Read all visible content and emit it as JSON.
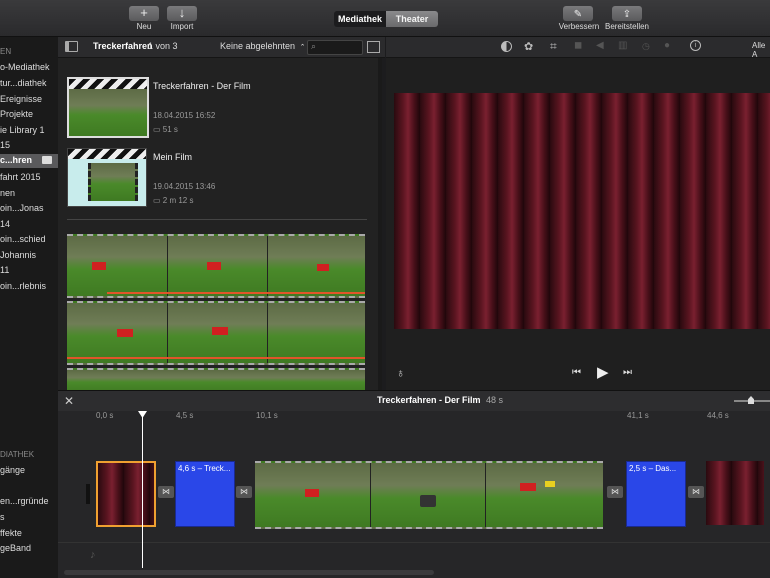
{
  "toolbar": {
    "new_label": "Neu",
    "import_label": "Import",
    "library_tab": "Mediathek",
    "theater_tab": "Theater",
    "enhance_label": "Verbessern",
    "share_label": "Bereitstellen"
  },
  "sidebar": {
    "items": [
      {
        "label": "EN"
      },
      {
        "label": "o-Mediathek"
      },
      {
        "label": "tur...diathek"
      },
      {
        "label": "Ereignisse"
      },
      {
        "label": "Projekte"
      },
      {
        "label": "ie Library 1"
      },
      {
        "label": "15"
      },
      {
        "label": "c...hren"
      },
      {
        "label": "fahrt 2015"
      },
      {
        "label": "nen"
      },
      {
        "label": "oin...Jonas"
      },
      {
        "label": "14"
      },
      {
        "label": "oin...schied"
      },
      {
        "label": " Johannis"
      },
      {
        "label": "11"
      },
      {
        "label": "oin...rlebnis"
      }
    ],
    "lower_items": [
      {
        "label": "DIATHEK"
      },
      {
        "label": "gänge"
      },
      {
        "label": "en...rgründe"
      },
      {
        "label": "s"
      },
      {
        "label": "ffekte"
      },
      {
        "label": "geBand"
      }
    ]
  },
  "browser": {
    "title": "Treckerfahren",
    "count": "1 von 3",
    "filter": "Keine abgelehnten",
    "projects": [
      {
        "title": "Treckerfahren - Der Film",
        "date": "18.04.2015 16:52",
        "duration": "51 s"
      },
      {
        "title": "Mein Film",
        "date": "19.04.2015 13:46",
        "duration": "2 m 12 s"
      }
    ]
  },
  "viewer": {
    "show_all": "Alle A"
  },
  "timeline": {
    "title": "Treckerfahren - Der Film",
    "duration": "48 s",
    "ticks": [
      "0,0 s",
      "4,5 s",
      "10,1 s",
      "41,1 s",
      "44,6 s"
    ],
    "clip_title_1": "4,6 s – Treck...",
    "clip_title_2": "2,5 s – Das..."
  },
  "colors": {
    "accent_orange": "#f0a030",
    "title_clip_blue": "#2a47e8",
    "selection_red": "#e0552a"
  }
}
